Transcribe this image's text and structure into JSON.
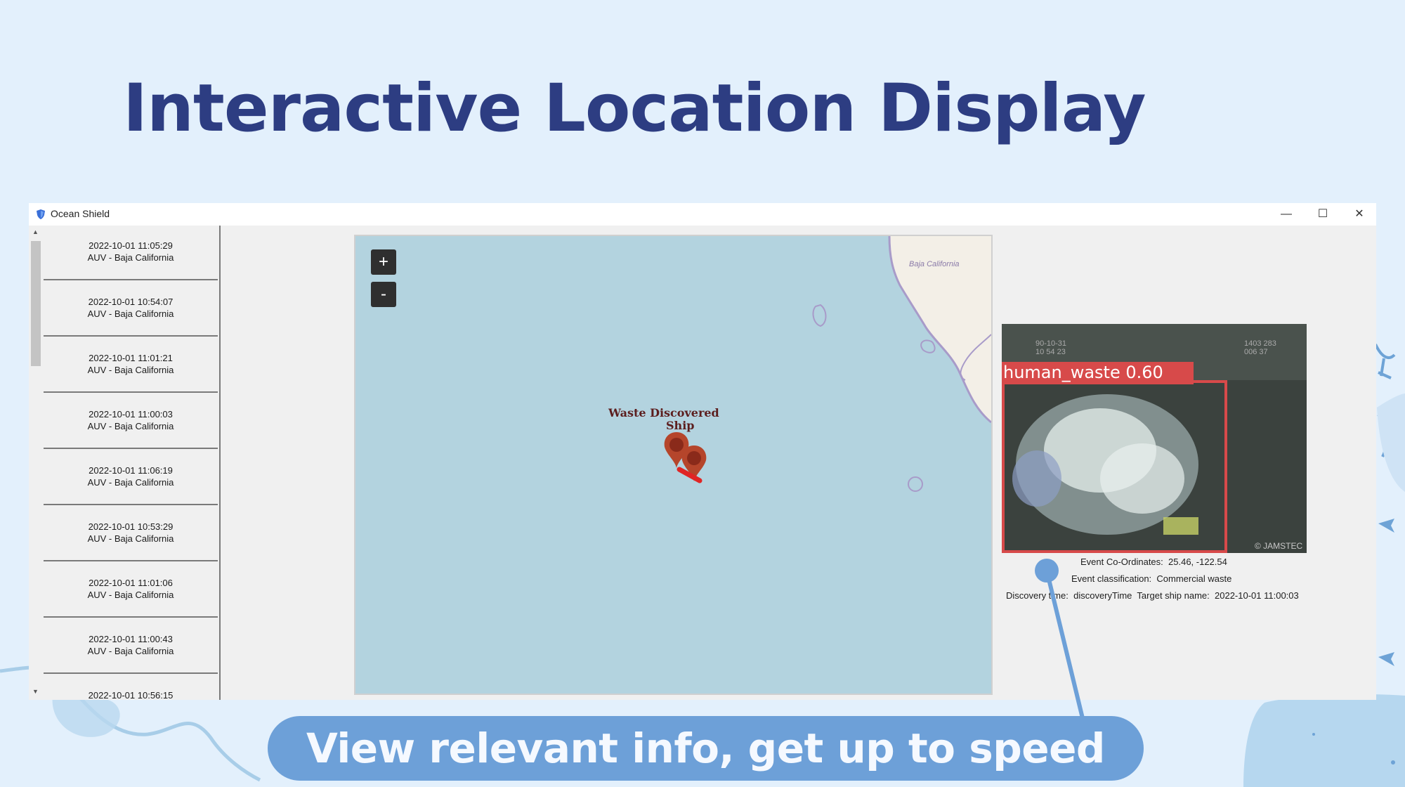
{
  "slide": {
    "title": "Interactive Location Display",
    "banner": "View relevant info, get up to speed"
  },
  "colors": {
    "background": "#e3f0fc",
    "title": "#2d3d82",
    "banner": "#6da0d8",
    "map_water": "#b3d3df",
    "marker": "#b5452b",
    "detection_box": "#d74a4a"
  },
  "window": {
    "title": "Ocean Shield",
    "icon": "shield-icon",
    "controls": {
      "minimize": "—",
      "maximize": "☐",
      "close": "✕"
    }
  },
  "event_list": {
    "items": [
      {
        "time": "2022-10-01 11:05:29",
        "source": "AUV - Baja California"
      },
      {
        "time": "2022-10-01 10:54:07",
        "source": "AUV - Baja California"
      },
      {
        "time": "2022-10-01 11:01:21",
        "source": "AUV - Baja California"
      },
      {
        "time": "2022-10-01 11:00:03",
        "source": "AUV - Baja California"
      },
      {
        "time": "2022-10-01 11:06:19",
        "source": "AUV - Baja California"
      },
      {
        "time": "2022-10-01 10:53:29",
        "source": "AUV - Baja California"
      },
      {
        "time": "2022-10-01 11:01:06",
        "source": "AUV - Baja California"
      },
      {
        "time": "2022-10-01 11:00:43",
        "source": "AUV - Baja California"
      },
      {
        "time": "2022-10-01 10:56:15",
        "source": ""
      }
    ]
  },
  "map": {
    "zoom_in": "+",
    "zoom_out": "-",
    "region_label": "Baja California",
    "marker_label_line1": "Waste Discovered",
    "marker_label_line2": "Ship"
  },
  "detection": {
    "label": "human_waste 0.60",
    "overlay_left_line1": "90-10-31",
    "overlay_left_line2": "10 54 23",
    "overlay_right_line1": "1403 283",
    "overlay_right_line2": "006  37",
    "watermark": "© JAMSTEC"
  },
  "event_info": {
    "coords_label": "Event Co-Ordinates:",
    "coords_value": "25.46, -122.54",
    "class_label": "Event classification:",
    "class_value": "Commercial waste",
    "discovery_label": "Discovery time:",
    "discovery_value": "discoveryTime",
    "ship_label": "Target ship name:",
    "ship_value": "2022-10-01 11:00:03"
  }
}
